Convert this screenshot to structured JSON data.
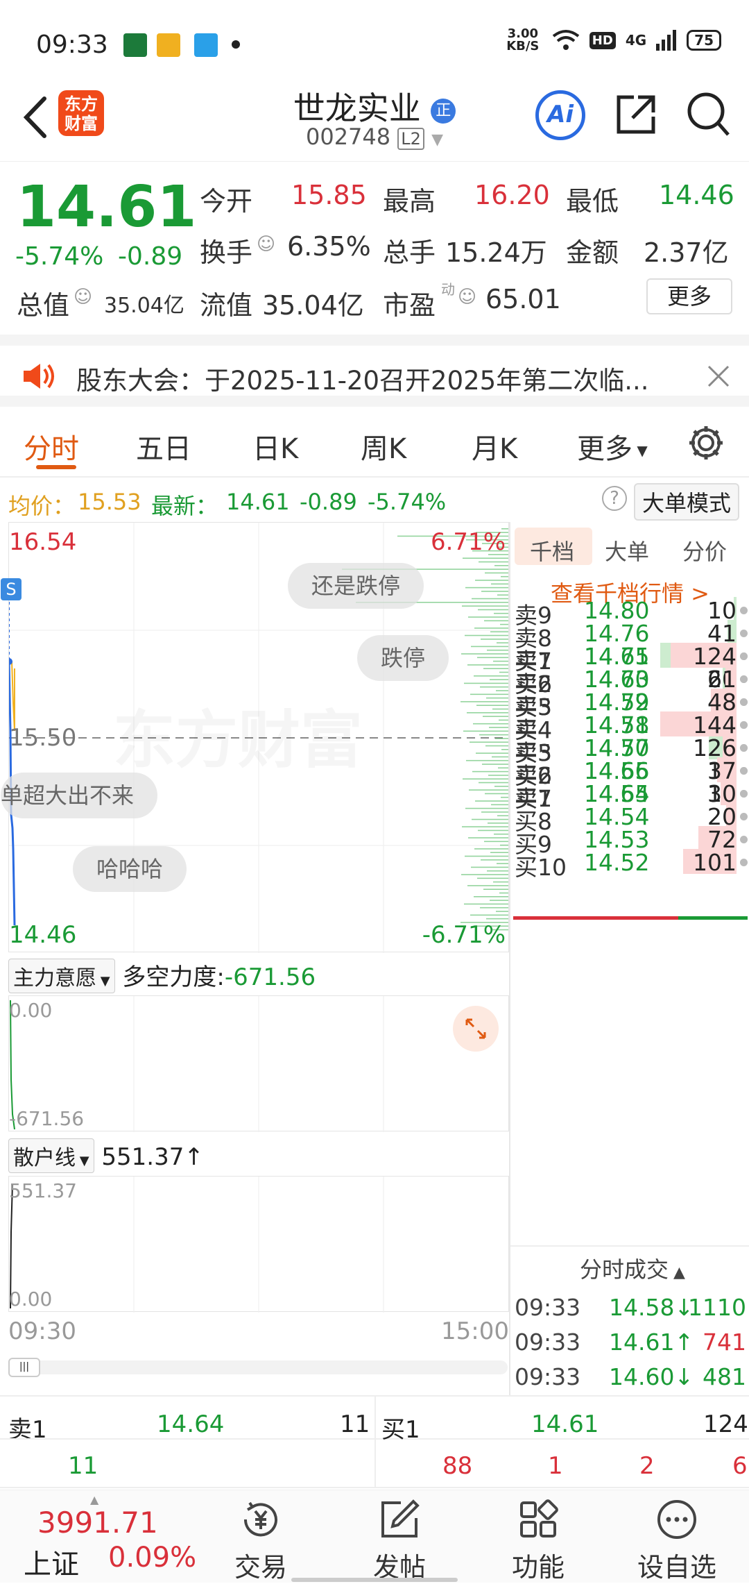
{
  "status_bar": {
    "time": "09:33",
    "speed": "3.00 KB/S",
    "hd": "HD",
    "network": "4G",
    "battery": "75"
  },
  "header": {
    "logo_line1": "东方",
    "logo_line2": "财富",
    "name": "世龙实业",
    "badge": "正",
    "code": "002748",
    "level": "L2",
    "ai_label": "Ai"
  },
  "quote": {
    "price": "14.61",
    "change_pct": "-5.74%",
    "change": "-0.89",
    "open_label": "今开",
    "open": "15.85",
    "high_label": "最高",
    "high": "16.20",
    "low_label": "最低",
    "low": "14.46",
    "turnover_label": "换手",
    "turnover": "6.35%",
    "volume_label": "总手",
    "volume": "15.24万",
    "amount_label": "金额",
    "amount": "2.37亿",
    "mcap_label": "总值",
    "mcap": "35.04亿",
    "float_label": "流值",
    "float": "35.04亿",
    "pe_label": "市盈",
    "pe_sup": "动",
    "pe": "65.01",
    "more_label": "更多"
  },
  "notice": {
    "text": "股东大会：于2025-11-20召开2025年第二次临..."
  },
  "tabs": [
    "分时",
    "五日",
    "日K",
    "周K",
    "月K",
    "更多"
  ],
  "info_line": {
    "avg_label": "均价：",
    "avg": "15.53",
    "latest_label": "最新：",
    "latest": "14.61",
    "chg": "-0.89",
    "pct": "-5.74%",
    "mode_btn": "大单模式"
  },
  "chart": {
    "top_price": "16.54",
    "top_pct": "6.71%",
    "mid_price": "15.50",
    "bottom_price": "14.46",
    "bottom_pct": "-6.71%",
    "watermark": "东方财富",
    "marker": "S",
    "bubbles": [
      "还是跌停",
      "跌停",
      "单超大出不来",
      "哈哈哈"
    ],
    "time_start": "09:30",
    "time_end": "15:00"
  },
  "indicator1": {
    "name": "主力意愿",
    "label": "多空力度:",
    "value": "-671.56",
    "top": "0.00",
    "bottom": "-671.56"
  },
  "indicator2": {
    "name": "散户线",
    "value": "551.37↑",
    "top": "551.37",
    "bottom": "0.00"
  },
  "depth_tabs": [
    "千档",
    "大单",
    "分价"
  ],
  "depth_link": "查看千档行情 >",
  "asks": [
    {
      "label": "卖9",
      "price": "14.80",
      "vol": "10"
    },
    {
      "label": "卖8",
      "price": "14.76",
      "vol": "41"
    },
    {
      "label": "卖7",
      "price": "14.75",
      "vol": "337"
    },
    {
      "label": "卖6",
      "price": "14.73",
      "vol": "60"
    },
    {
      "label": "卖5",
      "price": "14.72",
      "vol": "3"
    },
    {
      "label": "卖4",
      "price": "14.71",
      "vol": "132"
    },
    {
      "label": "卖3",
      "price": "14.70",
      "vol": "124"
    },
    {
      "label": "卖2",
      "price": "14.65",
      "vol": "10"
    },
    {
      "label": "卖1",
      "price": "14.64",
      "vol": "11"
    }
  ],
  "bids": [
    {
      "label": "买1",
      "price": "14.61",
      "vol": "124"
    },
    {
      "label": "买2",
      "price": "14.60",
      "vol": "21"
    },
    {
      "label": "买3",
      "price": "14.59",
      "vol": "48"
    },
    {
      "label": "买4",
      "price": "14.58",
      "vol": "144"
    },
    {
      "label": "买5",
      "price": "14.57",
      "vol": "26"
    },
    {
      "label": "买6",
      "price": "14.56",
      "vol": "37"
    },
    {
      "label": "买7",
      "price": "14.55",
      "vol": "30"
    },
    {
      "label": "买8",
      "price": "14.54",
      "vol": "20"
    },
    {
      "label": "买9",
      "price": "14.53",
      "vol": "72"
    },
    {
      "label": "买10",
      "price": "14.52",
      "vol": "101"
    }
  ],
  "trades_title": "分时成交",
  "trades": [
    {
      "time": "09:33",
      "price": "14.58↓",
      "vol": "1110"
    },
    {
      "time": "09:33",
      "price": "14.61↑",
      "vol": "741"
    },
    {
      "time": "09:33",
      "price": "14.60↓",
      "vol": "481"
    }
  ],
  "strip": {
    "sell_label": "卖1",
    "sell_price": "14.64",
    "sell_vol": "11",
    "sell_detail": "11",
    "buy_label": "买1",
    "buy_price": "14.61",
    "buy_vol": "124",
    "buy_details": [
      "88",
      "1",
      "2",
      "6"
    ]
  },
  "nav": {
    "index_value": "3991.71",
    "index_name": "上证",
    "index_pct": "0.09%",
    "items": [
      "交易",
      "发帖",
      "功能",
      "设自选"
    ]
  },
  "colors": {
    "red": "#d9303a",
    "green": "#1a9a35",
    "orange": "#e05a12",
    "blue": "#2a6ae0"
  }
}
